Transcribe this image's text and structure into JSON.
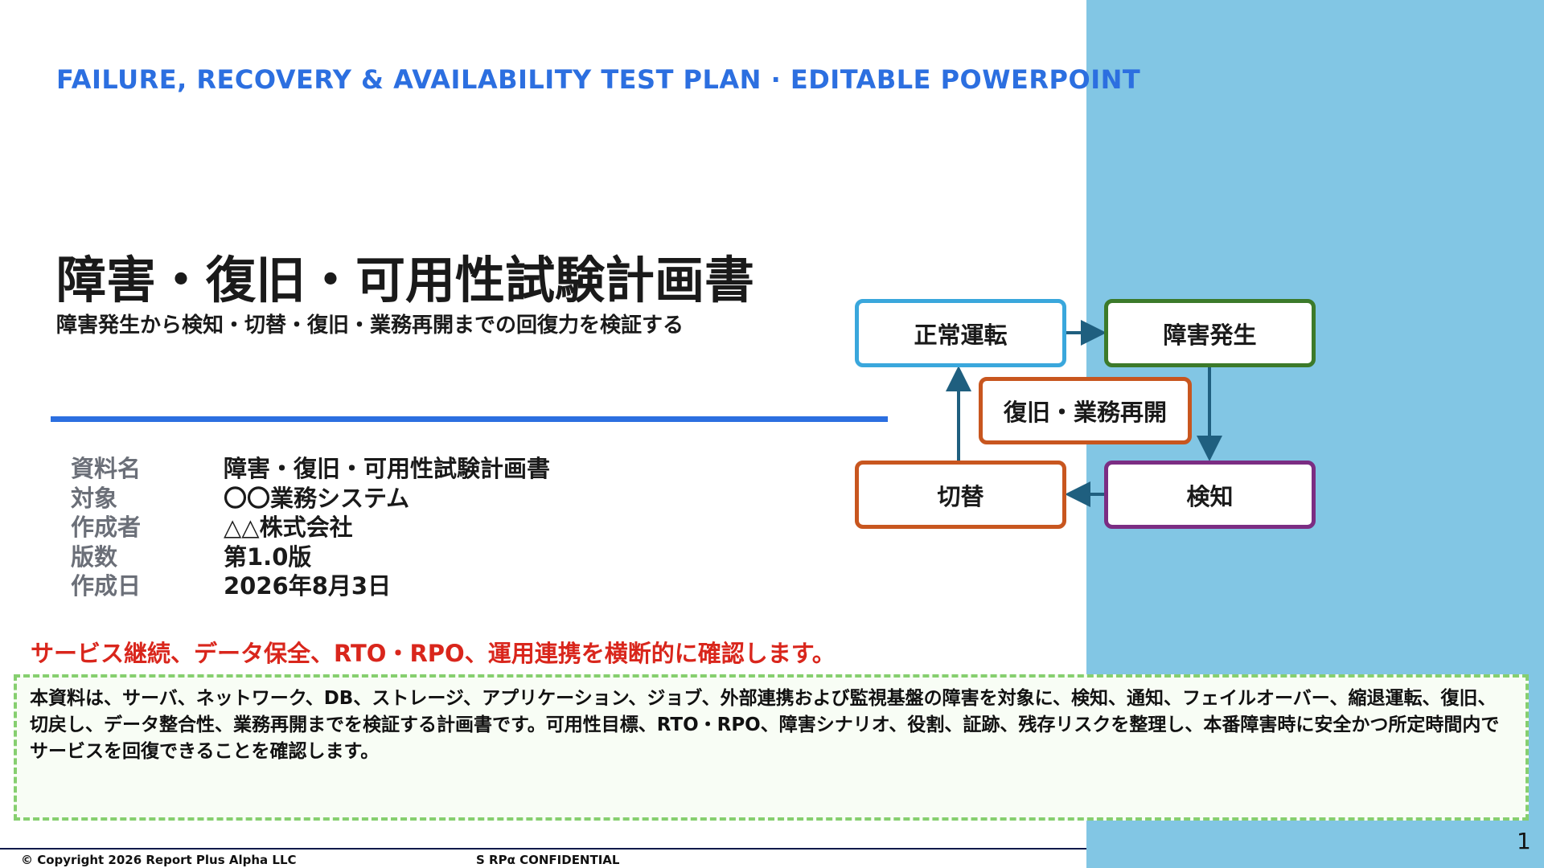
{
  "slide": {
    "header": "FAILURE, RECOVERY & AVAILABILITY TEST PLAN · EDITABLE POWERPOINT",
    "title": "障害・復旧・可用性試験計画書",
    "subtitle": "障害発生から検知・切替・復旧・業務再開までの回復力を検証する",
    "meta": [
      {
        "label": "資料名",
        "value": "障害・復旧・可用性試験計画書"
      },
      {
        "label": "対象",
        "value": "〇〇業務システム"
      },
      {
        "label": "作成者",
        "value": "△△株式会社"
      },
      {
        "label": "版数",
        "value": "第1.0版"
      },
      {
        "label": "作成日",
        "value": "2026年8月3日"
      }
    ],
    "highlight": "サービス継続、データ保全、RTO・RPO、運用連携を横断的に確認します。",
    "description": "本資料は、サーバ、ネットワーク、DB、ストレージ、アプリケーション、ジョブ、外部連携および監視基盤の障害を対象に、検知、通知、フェイルオーバー、縮退運転、復旧、切戻し、データ整合性、業務再開までを検証する計画書です。可用性目標、RTO・RPO、障害シナリオ、役割、証跡、残存リスクを整理し、本番障害時に安全かつ所定時間内でサービスを回復できることを確認します。",
    "footer": {
      "copyright": "© Copyright 2026 Report Plus Alpha LLC",
      "confidential": "S RPα CONFIDENTIAL",
      "page": "1"
    }
  },
  "flow": {
    "nodes": {
      "normal": "正常運転",
      "fault": "障害発生",
      "recover": "復旧・業務再開",
      "switch": "切替",
      "detect": "検知"
    }
  },
  "colors": {
    "accent_blue": "#2C6FE0",
    "panel": "#82C6E4",
    "highlight_red": "#D9261C",
    "dashed_green": "#86CF6F",
    "arrow": "#1F5F7F"
  }
}
